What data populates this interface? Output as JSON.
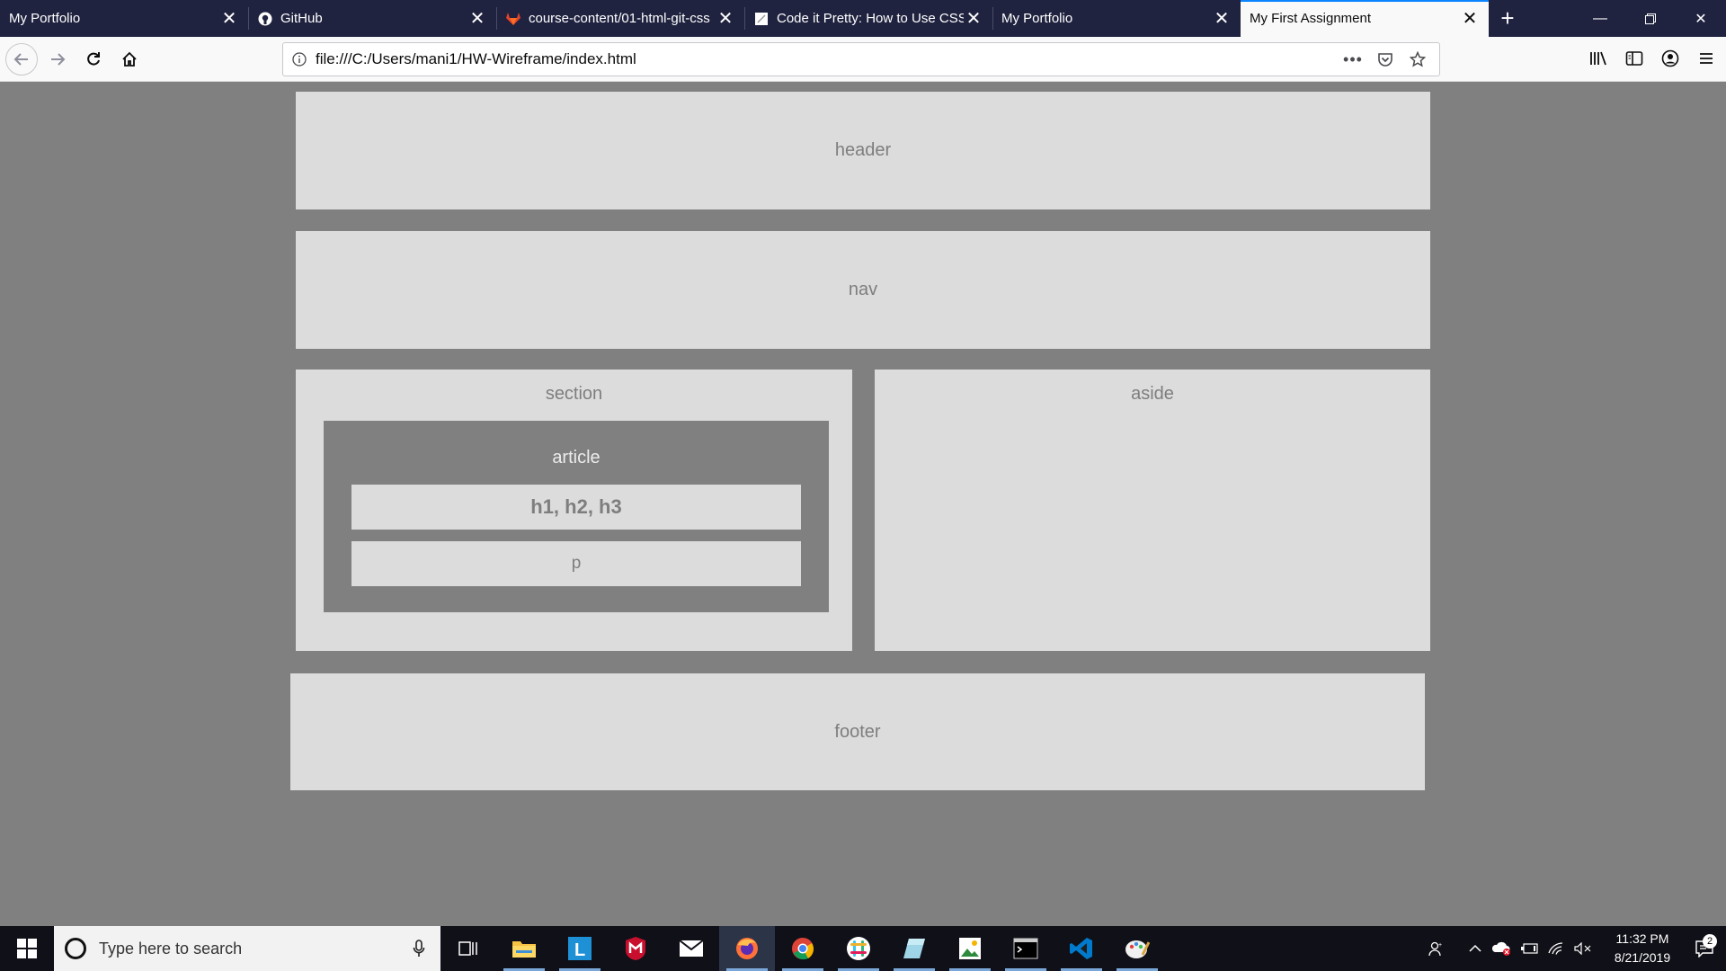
{
  "browser": {
    "tabs": [
      {
        "title": "My Portfolio",
        "icon": "none",
        "active": false
      },
      {
        "title": "GitHub",
        "icon": "github-icon",
        "active": false
      },
      {
        "title": "course-content/01-html-git-css",
        "icon": "gitlab-icon",
        "active": false
      },
      {
        "title": "Code it Pretty: How to Use CSS",
        "icon": "page-icon",
        "active": false
      },
      {
        "title": "My Portfolio",
        "icon": "none",
        "active": false
      },
      {
        "title": "My First Assignment",
        "icon": "none",
        "active": true
      }
    ],
    "url": "file:///C:/Users/mani1/HW-Wireframe/index.html",
    "accent_color": "#0a84ff"
  },
  "page": {
    "header": "header",
    "nav": "nav",
    "section": "section",
    "aside": "aside",
    "article": "article",
    "headings": "h1, h2, h3",
    "paragraph": "p",
    "footer": "footer",
    "background_color": "#808080",
    "box_color": "#dcdcdc"
  },
  "taskbar": {
    "search_placeholder": "Type here to search",
    "time": "11:32 PM",
    "date": "8/21/2019",
    "notification_count": "2"
  }
}
